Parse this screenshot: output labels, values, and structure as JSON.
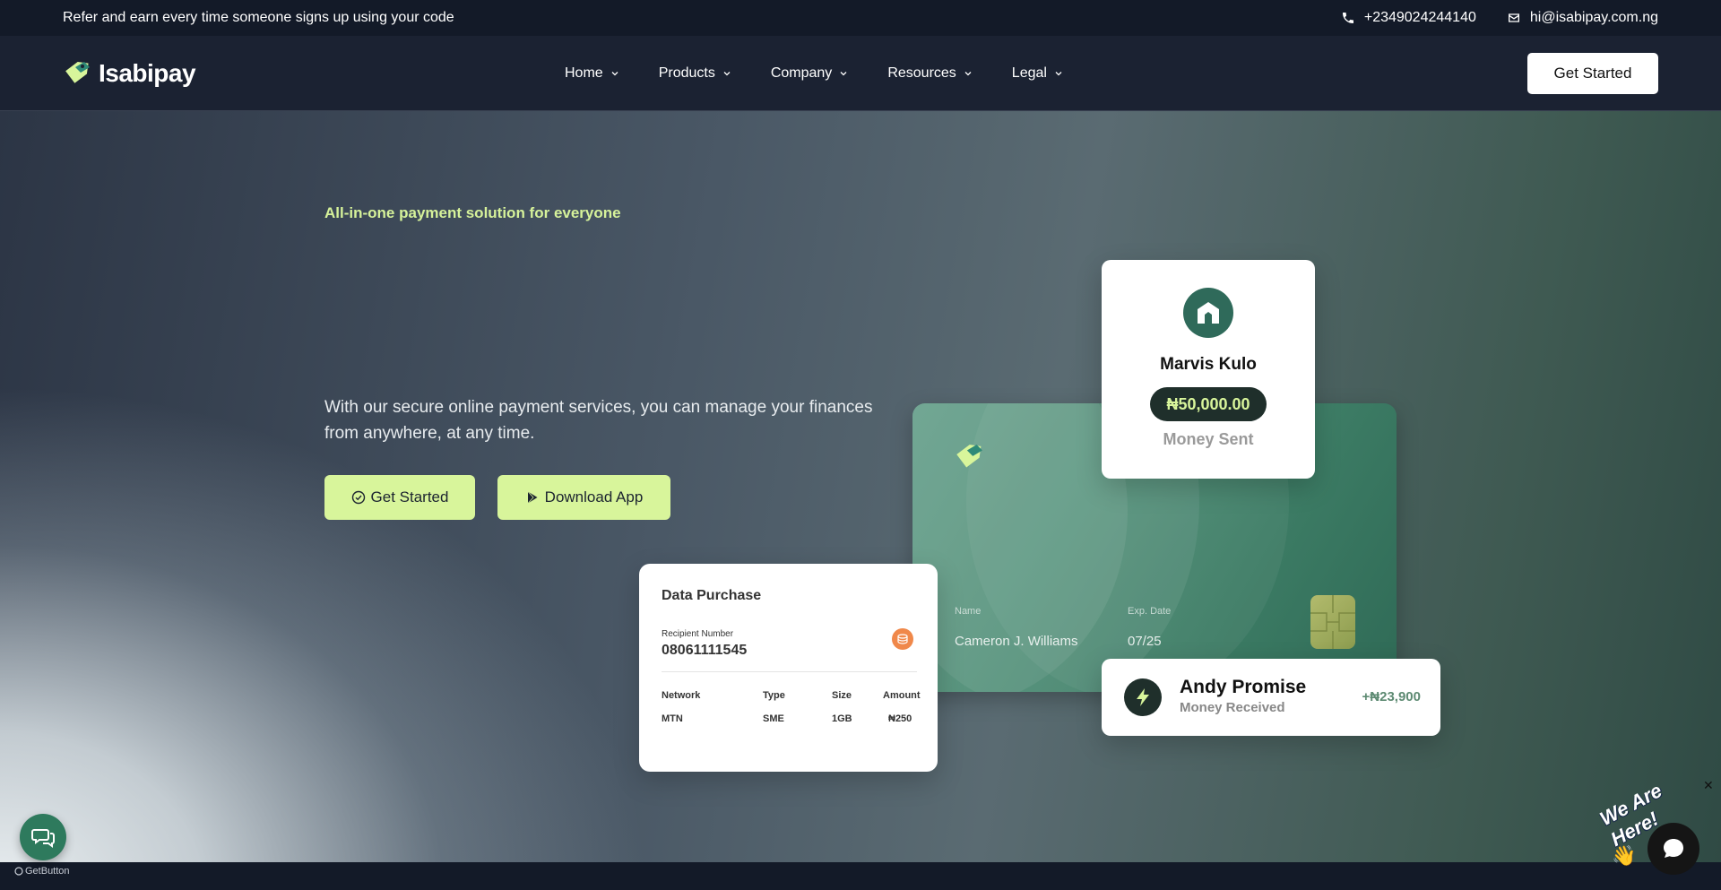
{
  "topbar": {
    "promo": "Refer and earn every time someone signs up using your code",
    "phone": "+2349024244140",
    "email": "hi@isabipay.com.ng"
  },
  "nav": {
    "brand": "Isabipay",
    "items": [
      {
        "label": "Home"
      },
      {
        "label": "Products"
      },
      {
        "label": "Company"
      },
      {
        "label": "Resources"
      },
      {
        "label": "Legal"
      }
    ],
    "cta": "Get Started"
  },
  "hero": {
    "tagline": "All-in-one payment solution for everyone",
    "description": "With our secure online payment services, you can manage your finances from anywhere, at any time.",
    "primary_button": "Get Started",
    "secondary_button": "Download App"
  },
  "card": {
    "name_label": "Name",
    "name_value": "Cameron J. Williams",
    "exp_label": "Exp. Date",
    "exp_value": "07/25"
  },
  "transfer": {
    "name": "Marvis Kulo",
    "amount": "₦50,000.00",
    "status": "Money Sent"
  },
  "data_purchase": {
    "title": "Data Purchase",
    "recipient_label": "Recipient Number",
    "recipient_number": "08061111545",
    "columns": [
      "Network",
      "Type",
      "Size",
      "Amount"
    ],
    "row": [
      "MTN",
      "SME",
      "1GB",
      "₦250"
    ]
  },
  "received": {
    "name": "Andy Promise",
    "status": "Money Received",
    "amount": "+₦23,900"
  },
  "widgets": {
    "getbutton": "GetButton",
    "here_text": "We Are Here!",
    "close": "✕"
  },
  "colors": {
    "accent": "#d8f59b",
    "brand_green": "#2f6a5a",
    "dark": "#131a28"
  }
}
